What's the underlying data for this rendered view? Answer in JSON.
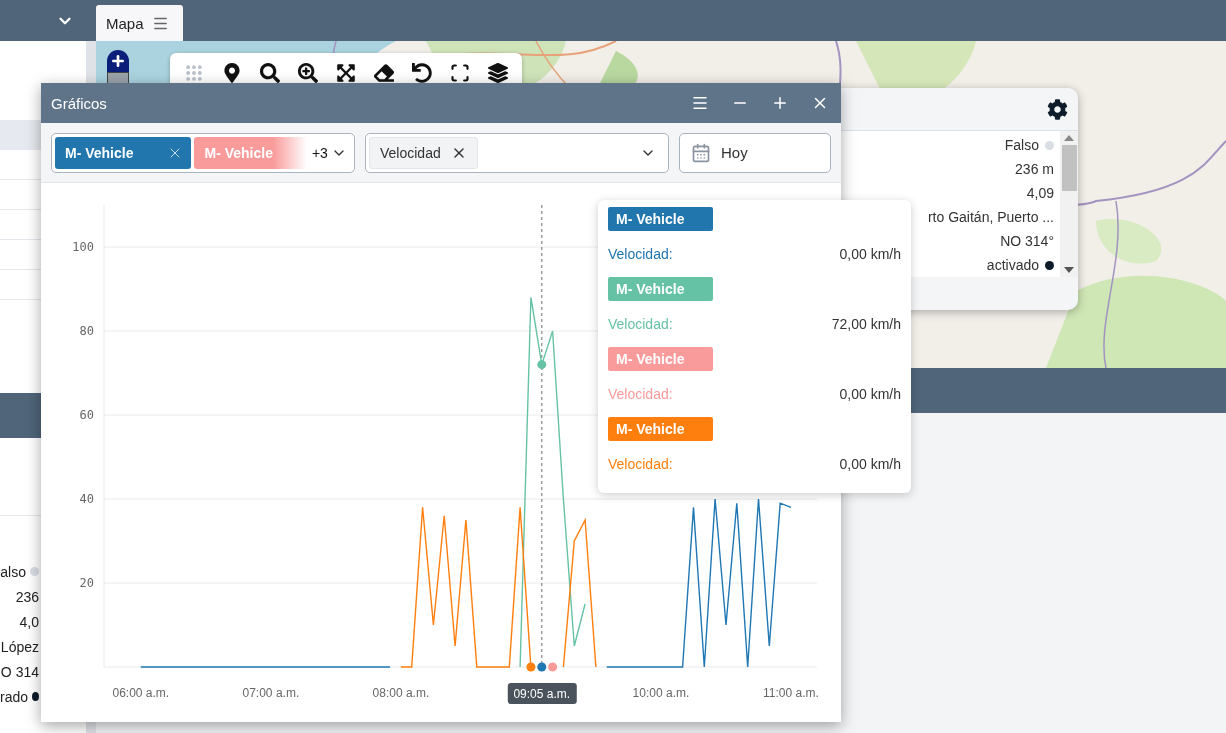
{
  "top_bar": {
    "tab": {
      "label": "Mapa",
      "selected": true
    }
  },
  "left_panel": {
    "rows": [
      {
        "text": "also",
        "color": "#d9dde5"
      },
      {
        "text": "236"
      },
      {
        "text": "4,0"
      },
      {
        "text": "López"
      },
      {
        "text": "O 314"
      },
      {
        "text": "rado",
        "color": "#0d1b2a"
      }
    ]
  },
  "info_panel": {
    "rows": [
      {
        "text": "Falso",
        "color": "#d9dde5"
      },
      {
        "text": "236 m"
      },
      {
        "text": "4,09"
      },
      {
        "text": "rto Gaitán, Puerto ..."
      },
      {
        "text": "NO 314°"
      },
      {
        "text": "activado",
        "color": "#0d1b2a"
      }
    ]
  },
  "window": {
    "title": "Gráficos",
    "filters": {
      "vehicles": {
        "chips": [
          {
            "label": "M- Vehicle",
            "color": "#2176ae"
          },
          {
            "label": "M- Vehicle",
            "color": "#f99b9b"
          }
        ],
        "more": "+3"
      },
      "variables": {
        "chips": [
          {
            "label": "Velocidad"
          }
        ]
      },
      "date": {
        "value": "Hoy"
      }
    },
    "chart_data": {
      "type": "line",
      "x": [
        360,
        365,
        370,
        375,
        380,
        385,
        390,
        395,
        400,
        405,
        410,
        415,
        420,
        425,
        430,
        435,
        440,
        445,
        450,
        455,
        460,
        465,
        470,
        475,
        480,
        485,
        490,
        495,
        500,
        505,
        510,
        515,
        520,
        525,
        530,
        535,
        540,
        545,
        550,
        555,
        560,
        565,
        570,
        575,
        580,
        585,
        590,
        595,
        600,
        605,
        610,
        615,
        620,
        625,
        630,
        635,
        640,
        645,
        650,
        655,
        660
      ],
      "xlim": [
        343,
        672
      ],
      "ylim": [
        0,
        110
      ],
      "yticks": [
        20,
        40,
        60,
        80,
        100
      ],
      "grid": true,
      "xticks": [
        {
          "value": 360,
          "label": "06:00 a.m."
        },
        {
          "value": 420,
          "label": "07:00 a.m."
        },
        {
          "value": 480,
          "label": "08:00 a.m."
        },
        {
          "value": 600,
          "label": "10:00 a.m."
        },
        {
          "value": 660,
          "label": "11:00 a.m."
        }
      ],
      "ref_lines": [
        {
          "axis": "x",
          "value": 545
        }
      ],
      "annotations": [
        "09:05 a.m."
      ],
      "series": [
        {
          "name": "M- Vehicle",
          "color": "#1f77b4",
          "values": [
            0,
            0,
            0,
            0,
            0,
            0,
            0,
            0,
            0,
            0,
            0,
            0,
            0,
            0,
            0,
            0,
            0,
            0,
            0,
            0,
            0,
            0,
            0,
            0,
            null,
            null,
            null,
            null,
            null,
            null,
            null,
            null,
            null,
            null,
            null,
            null,
            null,
            0,
            null,
            null,
            null,
            null,
            null,
            0,
            0,
            0,
            0,
            0,
            0,
            0,
            0,
            38,
            0,
            40,
            10,
            39,
            0,
            40,
            5,
            39,
            38
          ]
        },
        {
          "name": "M- Vehicle",
          "color": "#66c2a5",
          "values": [
            null,
            null,
            null,
            null,
            null,
            null,
            null,
            null,
            null,
            null,
            null,
            null,
            null,
            null,
            null,
            null,
            null,
            null,
            null,
            null,
            null,
            null,
            null,
            null,
            null,
            null,
            null,
            null,
            null,
            null,
            null,
            null,
            null,
            null,
            null,
            0,
            88,
            72,
            80,
            40,
            5,
            15,
            null,
            null,
            null,
            null,
            null,
            null,
            null,
            null,
            null,
            null,
            null,
            null,
            null,
            null,
            null,
            null,
            null,
            null,
            null
          ]
        },
        {
          "name": "M- Vehicle",
          "color": "#fc9a9a",
          "marker": true,
          "values": [
            null,
            null,
            null,
            null,
            null,
            null,
            null,
            null,
            null,
            null,
            null,
            null,
            null,
            null,
            null,
            null,
            null,
            null,
            null,
            null,
            null,
            null,
            null,
            null,
            null,
            null,
            null,
            null,
            null,
            null,
            null,
            null,
            null,
            null,
            null,
            null,
            null,
            null,
            0,
            null,
            null,
            null,
            null,
            null,
            null,
            null,
            null,
            null,
            null,
            null,
            null,
            null,
            null,
            null,
            null,
            null,
            null,
            null,
            null,
            null,
            null
          ]
        },
        {
          "name": "M- Vehicle",
          "color": "#ff7f0e",
          "values": [
            null,
            null,
            null,
            null,
            null,
            null,
            null,
            null,
            null,
            null,
            null,
            null,
            null,
            null,
            null,
            null,
            null,
            null,
            null,
            null,
            null,
            null,
            null,
            null,
            0,
            0,
            38,
            10,
            36,
            5,
            35,
            0,
            0,
            0,
            0,
            38,
            0,
            null,
            null,
            0,
            30,
            35,
            0,
            null,
            null,
            null,
            null,
            null,
            null,
            null,
            null,
            null,
            null,
            null,
            null,
            null,
            null,
            null,
            null,
            null,
            null
          ]
        }
      ]
    },
    "tooltip": {
      "items": [
        {
          "color": "#2176ae",
          "label": "Velocidad:",
          "value": "0,00 km/h"
        },
        {
          "color": "#66c2a5",
          "label": "Velocidad:",
          "value": "72,00 km/h"
        },
        {
          "color": "#f99b9b",
          "label": "Velocidad:",
          "value": "0,00 km/h"
        },
        {
          "color": "#ff7f0e",
          "label": "Velocidad:",
          "value": "0,00 km/h"
        }
      ]
    }
  }
}
